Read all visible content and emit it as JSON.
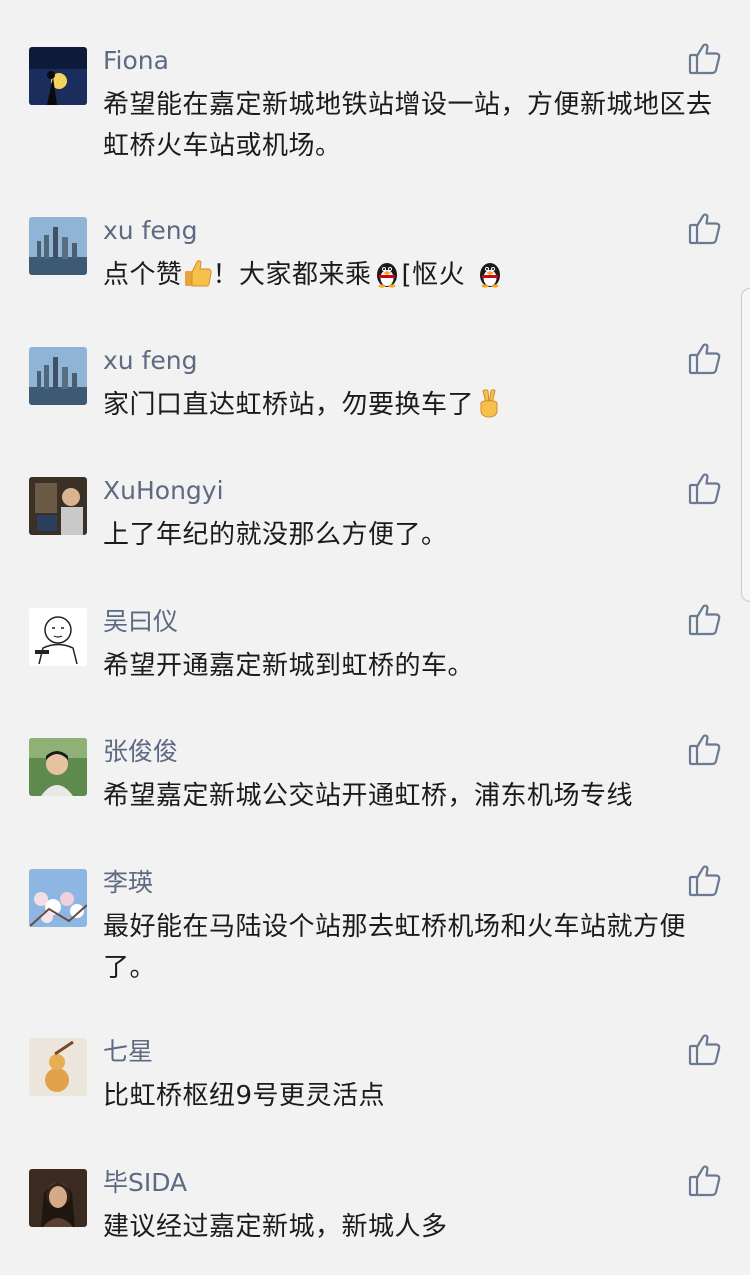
{
  "comments": [
    {
      "name": "Fiona",
      "text": "希望能在嘉定新城地铁站增设一站，方便新城地区去虹桥火车站或机场。"
    },
    {
      "name": "xu feng",
      "text_a": "点个赞",
      "text_b": "！大家都来乘",
      "text_c": "[怄火"
    },
    {
      "name": "xu feng",
      "text": "家门口直达虹桥站，勿要换车了"
    },
    {
      "name": "XuHongyi",
      "text": "上了年纪的就没那么方便了。"
    },
    {
      "name": "吴曰仪",
      "text": "希望开通嘉定新城到虹桥的车。"
    },
    {
      "name": "张俊俊",
      "text": "希望嘉定新城公交站开通虹桥，浦东机场专线"
    },
    {
      "name": "李瑛",
      "text": "最好能在马陆设个站那去虹桥机场和火车站就方便了。"
    },
    {
      "name": "七星",
      "text": "比虹桥枢纽9号更灵活点"
    },
    {
      "name": "毕SIDA",
      "text": "建议经过嘉定新城，新城人多"
    }
  ],
  "icons": {
    "like": "thumbs-up-outline-icon",
    "emoji_thumbs": "thumbs-up-emoji-icon",
    "emoji_penguin": "penguin-emoji-icon",
    "emoji_victory": "victory-hand-emoji-icon"
  },
  "colors": {
    "background": "#f2f2f2",
    "name": "#5d6a83",
    "text": "#1b1b1b",
    "like_icon": "#6b7a93"
  }
}
